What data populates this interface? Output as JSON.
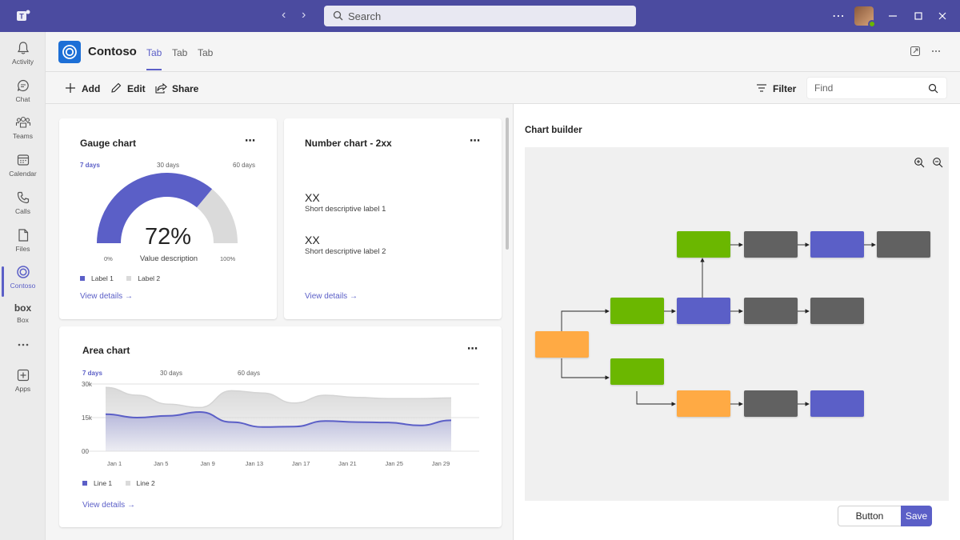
{
  "titlebar": {
    "search_placeholder": "Search",
    "more": "⋯"
  },
  "rail": [
    {
      "id": "activity",
      "label": "Activity"
    },
    {
      "id": "chat",
      "label": "Chat"
    },
    {
      "id": "teams",
      "label": "Teams"
    },
    {
      "id": "calendar",
      "label": "Calendar"
    },
    {
      "id": "calls",
      "label": "Calls"
    },
    {
      "id": "files",
      "label": "Files"
    },
    {
      "id": "contoso",
      "label": "Contoso",
      "active": true
    },
    {
      "id": "box",
      "label": "Box",
      "logo_text": "box"
    },
    {
      "id": "more",
      "label": ""
    },
    {
      "id": "apps",
      "label": "Apps"
    }
  ],
  "app": {
    "title": "Contoso",
    "tabs": [
      "Tab",
      "Tab",
      "Tab"
    ],
    "active_tab": 0
  },
  "toolbar": {
    "add": "Add",
    "edit": "Edit",
    "share": "Share",
    "filter": "Filter",
    "find_placeholder": "Find"
  },
  "gauge_card": {
    "title": "Gauge chart",
    "ranges": [
      "7 days",
      "30 days",
      "60 days"
    ],
    "value": 72,
    "value_text": "72%",
    "value_description": "Value description",
    "min_label": "0%",
    "max_label": "100%",
    "legend": [
      "Label 1",
      "Label 2"
    ],
    "view_details": "View details →"
  },
  "number_card": {
    "title": "Number chart - 2xx",
    "items": [
      {
        "value": "XX",
        "label": "Short descriptive label 1"
      },
      {
        "value": "XX",
        "label": "Short descriptive label 2"
      }
    ],
    "view_details": "View details →"
  },
  "area_card": {
    "title": "Area chart",
    "ranges": [
      "7 days",
      "30 days",
      "60 days"
    ],
    "legend": [
      "Line 1",
      "Line 2"
    ],
    "view_details": "View details →"
  },
  "chart_data": {
    "type": "area",
    "x": [
      "Jan 1",
      "Jan 5",
      "Jan 9",
      "Jan 13",
      "Jan 17",
      "Jan 21",
      "Jan 25",
      "Jan 29"
    ],
    "y_ticks": [
      "00",
      "15k",
      "30k"
    ],
    "ylim": [
      0,
      30000
    ],
    "series": [
      {
        "name": "Line 1",
        "color": "#5b5fc7",
        "values": [
          16500,
          15000,
          15800,
          17500,
          13000,
          10800,
          11000,
          13500,
          13000,
          12800,
          11500,
          13800
        ]
      },
      {
        "name": "Line 2",
        "color": "#d4d4d4",
        "values": [
          28500,
          25000,
          21000,
          19500,
          27000,
          26000,
          21500,
          25000,
          24000,
          23500,
          23500,
          23800
        ]
      }
    ],
    "grid": true,
    "legend_position": "bottom-left"
  },
  "builder": {
    "title": "Chart builder",
    "button_label": "Button",
    "save_label": "Save"
  },
  "colors": {
    "accent": "#5b5fc7",
    "green": "#6bb700",
    "orange": "#ffaa44",
    "gray": "#616161",
    "titlebar": "#4b4ba0"
  }
}
